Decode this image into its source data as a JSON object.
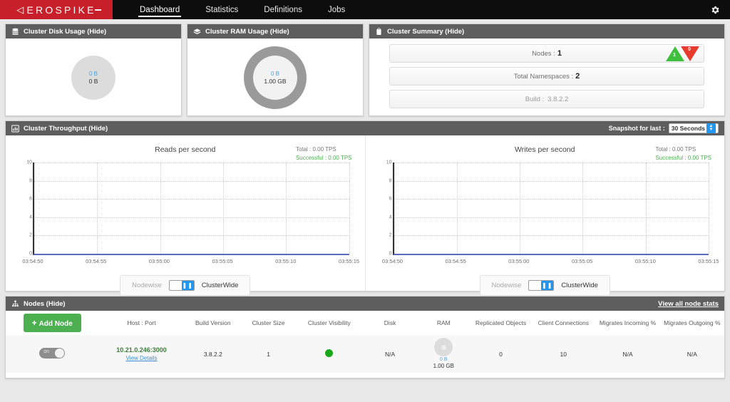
{
  "brand": {
    "name": "EROSPIKE",
    "arrow": "◁",
    "color": "#c8202b"
  },
  "nav": {
    "items": [
      {
        "label": "Dashboard",
        "active": true
      },
      {
        "label": "Statistics",
        "active": false
      },
      {
        "label": "Definitions",
        "active": false
      },
      {
        "label": "Jobs",
        "active": false
      }
    ],
    "settings_icon": "gear-icon"
  },
  "disk_panel": {
    "title": "Cluster Disk Usage (Hide)",
    "icon": "database-icon",
    "used": "0 B",
    "total": "0 B"
  },
  "ram_panel": {
    "title": "Cluster RAM Usage (Hide)",
    "icon": "memory-icon",
    "used": "0 B",
    "total": "1.00 GB"
  },
  "summary_panel": {
    "title": "Cluster Summary (Hide)",
    "icon": "clipboard-icon",
    "rows": [
      {
        "label": "Nodes :",
        "value": "1",
        "muted": false
      },
      {
        "label": "Total Namespaces :",
        "value": "2",
        "muted": false
      },
      {
        "label": "Build :",
        "value": "3.8.2.2",
        "muted": true
      }
    ],
    "up_count": "1",
    "down_count": "0",
    "up_color": "#3ec03e",
    "down_color": "#e83b2e"
  },
  "throughput_panel": {
    "title": "Cluster Throughput (Hide)",
    "icon": "bar-chart-icon",
    "snapshot_label": "Snapshot for last :",
    "snapshot_value": "30 Seconds",
    "toggle_left": "Nodewise",
    "toggle_right": "ClusterWide",
    "toggle_state": "ClusterWide"
  },
  "chart_data": [
    {
      "type": "line",
      "title": "Reads per second",
      "xlabel": "",
      "ylabel": "",
      "ylim": [
        0,
        10
      ],
      "yticks": [
        0,
        2,
        4,
        6,
        8,
        10
      ],
      "ytick_labels": [
        "0",
        "2",
        "4",
        "6",
        "8",
        "10"
      ],
      "x": [
        "03:54:50",
        "03:54:55",
        "03:55:00",
        "03:55:05",
        "03:55:10",
        "03:55:15"
      ],
      "series": [
        {
          "name": "Reads",
          "values": [
            0,
            0,
            0,
            0,
            0,
            0
          ]
        }
      ],
      "grid": true,
      "annotations": {
        "total": "Total :  0.00 TPS",
        "successful": "Successful :  0.00 TPS"
      }
    },
    {
      "type": "line",
      "title": "Writes per second",
      "xlabel": "",
      "ylabel": "",
      "ylim": [
        0,
        10
      ],
      "yticks": [
        0,
        2,
        4,
        6,
        8,
        10
      ],
      "ytick_labels": [
        "0",
        "2",
        "4",
        "6",
        "8",
        "10"
      ],
      "x": [
        "03:54:50",
        "03:54:55",
        "03:55:00",
        "03:55:05",
        "03:55:10",
        "03:55:15"
      ],
      "series": [
        {
          "name": "Writes",
          "values": [
            0,
            0,
            0,
            0,
            0,
            0
          ]
        }
      ],
      "grid": true,
      "annotations": {
        "total": "Total :  0.00 TPS",
        "successful": "Successful :  0.00 TPS"
      }
    }
  ],
  "nodes_panel": {
    "title": "Nodes (Hide)",
    "icon": "sitemap-icon",
    "view_all_link": "View all node stats",
    "add_button": "Add Node",
    "columns": [
      "",
      "Host : Port",
      "Build Version",
      "Cluster Size",
      "Cluster Visibility",
      "Disk",
      "RAM",
      "Replicated Objects",
      "Client Connections",
      "Migrates Incoming %",
      "Migrates Outgoing %"
    ],
    "rows": [
      {
        "toggle": "on",
        "host": "10.21.0.246:3000",
        "details_link": "View Details",
        "build": "3.8.2.2",
        "cluster_size": "1",
        "visibility": "green",
        "disk": "N/A",
        "ram_used": "0 B",
        "ram_total": "1.00 GB",
        "replicated_objects": "0",
        "client_connections": "10",
        "migrates_in": "N/A",
        "migrates_out": "N/A"
      }
    ]
  }
}
